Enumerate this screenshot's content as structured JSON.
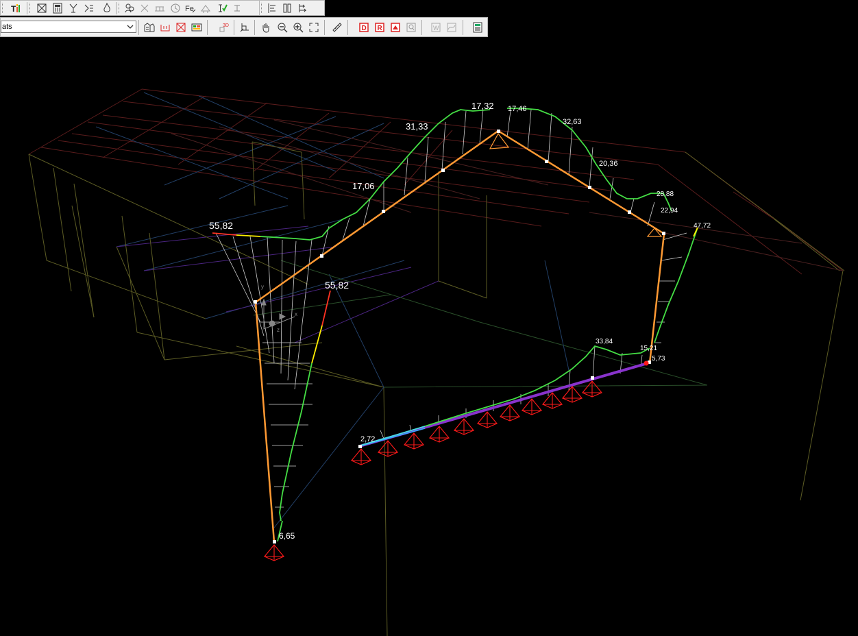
{
  "toolbar": {
    "combo_value": "ats",
    "icons_row1": [
      "tables-icon",
      "frame-icon",
      "calculator-icon",
      "weld-icon",
      "beam-icon",
      "fire-icon",
      "users-icon",
      "cross-icon",
      "supports-icon",
      "clock-icon",
      "fe-icon",
      "section-icon",
      "edit-check-icon",
      "beam-i-icon",
      "align-left-icon",
      "columns-icon",
      "arrows-icon"
    ],
    "icons_row2": [
      "structure-icon",
      "release-icon",
      "frame-red-icon",
      "results-icon",
      "3d-icon",
      "perspective-icon",
      "pan-icon",
      "zoom-out-icon",
      "zoom-in-icon",
      "zoom-fit-icon",
      "ruler-icon",
      "d-icon",
      "r-icon",
      "render-icon",
      "find-icon",
      "text-icon",
      "chart-icon",
      "calculator2-icon"
    ]
  },
  "viewport": {
    "axis_labels": {
      "x": "x",
      "y": "y",
      "z": "z"
    },
    "diagram_values": [
      {
        "id": "v1",
        "text": "55,82",
        "large": true
      },
      {
        "id": "v2",
        "text": "55,82",
        "large": true
      },
      {
        "id": "v3",
        "text": "17,06",
        "large": true
      },
      {
        "id": "v4",
        "text": "31,33",
        "large": true
      },
      {
        "id": "v5",
        "text": "17,32",
        "large": true
      },
      {
        "id": "v6",
        "text": "17,46",
        "large": false
      },
      {
        "id": "v7",
        "text": "32,63",
        "large": false
      },
      {
        "id": "v8",
        "text": "20,36",
        "large": false
      },
      {
        "id": "v9",
        "text": "28,88",
        "large": false
      },
      {
        "id": "v10",
        "text": "22,94",
        "large": false
      },
      {
        "id": "v11",
        "text": "47,72",
        "large": false
      },
      {
        "id": "v12",
        "text": "33,84",
        "large": false
      },
      {
        "id": "v13",
        "text": "15,21",
        "large": false
      },
      {
        "id": "v14",
        "text": "5,73",
        "large": false
      },
      {
        "id": "v15",
        "text": "2,72",
        "large": false
      },
      {
        "id": "v16",
        "text": "6,65",
        "large": false
      }
    ],
    "colors": {
      "member": "#ff9933",
      "diagram_green": "#33dd33",
      "diagram_yellow": "#ffee00",
      "diagram_red": "#ff3322",
      "wire_olive": "#6b6b2a",
      "wire_red": "#6a2020",
      "wire_blue": "#244d7a",
      "wire_purple": "#5a2c9a",
      "support": "#ff1a1a",
      "foundation": "#8833cc",
      "background": "#000000"
    }
  }
}
